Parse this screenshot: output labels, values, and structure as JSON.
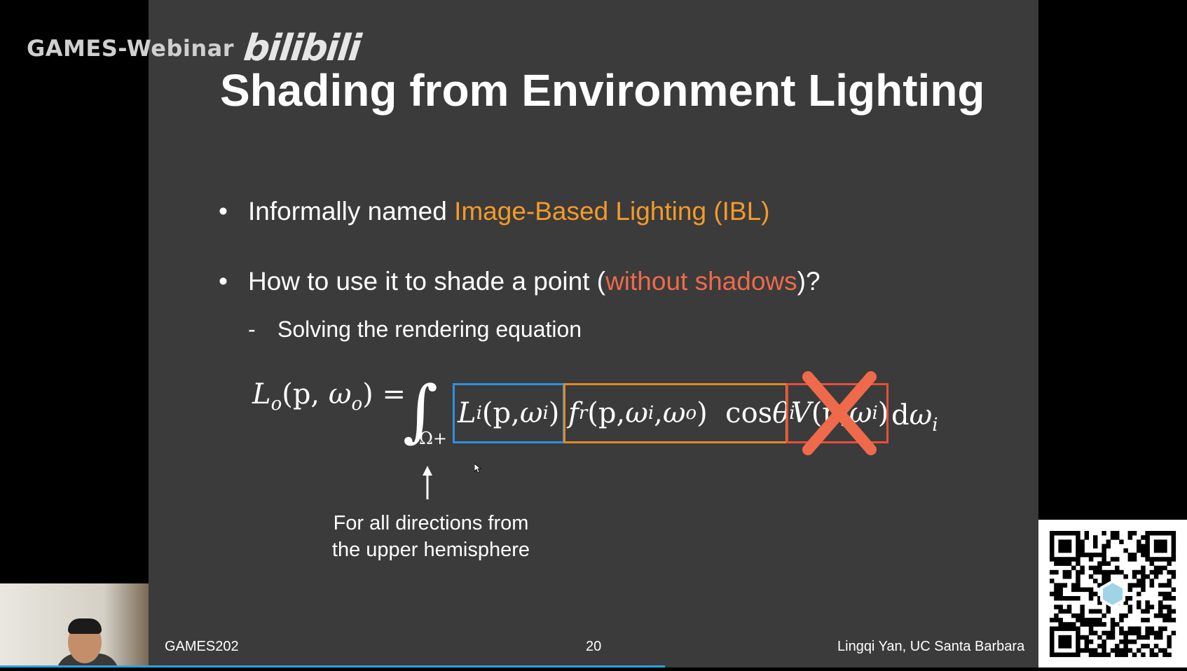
{
  "watermark": {
    "text": "GAMES-Webinar",
    "logo": "bilibili"
  },
  "slide": {
    "title": "Shading from Environment Lighting",
    "bullet1": {
      "prefix": "Informally named ",
      "highlight": "Image-Based Lighting (IBL)"
    },
    "bullet2": {
      "prefix": "How to use it to shade a point (",
      "highlight": "without shadows",
      "suffix": ")?"
    },
    "sub1": "Solving the rendering equation",
    "caption_line1": "For all directions from",
    "caption_line2": "the upper hemisphere",
    "footer_left": "GAMES202",
    "page_number": "20",
    "footer_right": "Lingqi Yan, UC Santa Barbara"
  },
  "colors": {
    "slide_bg": "#3b3b3b",
    "orange": "#f39a2b",
    "red": "#ee6a4a",
    "blue_box": "#2f8fe0",
    "orange_box": "#e08a2a",
    "red_box": "#e4503a",
    "progress": "#2aa3e6"
  },
  "icons": {
    "cross": "x-cross-icon",
    "arrow": "arrow-up-icon",
    "cursor": "mouse-cursor-icon",
    "qr": "qr-code"
  },
  "progress_fraction": 0.56
}
